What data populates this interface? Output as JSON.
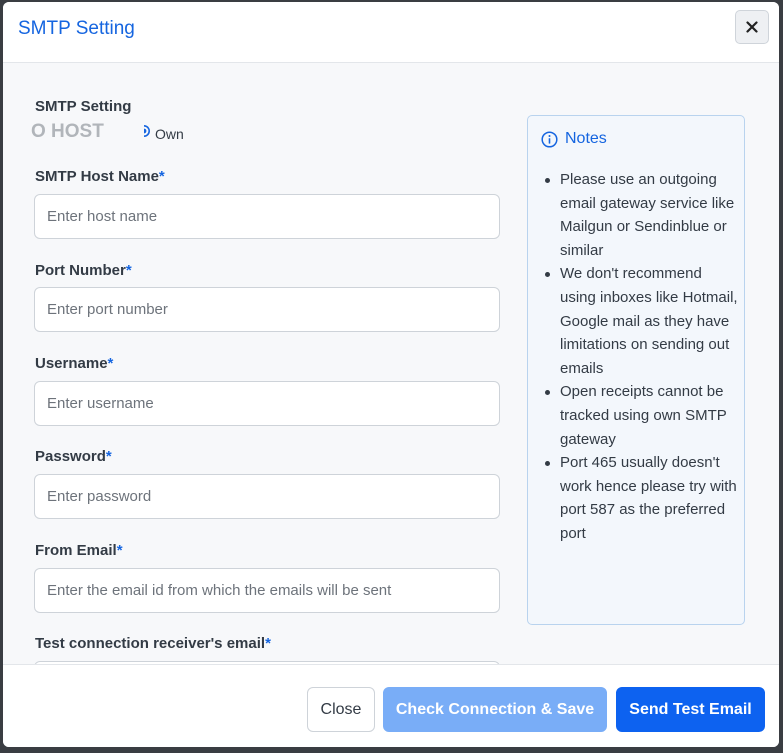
{
  "modal": {
    "title": "SMTP Setting",
    "close_icon": "close-icon"
  },
  "form": {
    "section_label": "SMTP Setting",
    "mode_options": [
      {
        "label": "O HOST",
        "selected": false
      },
      {
        "label": "Own",
        "selected": true
      }
    ],
    "required_marker": "*",
    "fields": [
      {
        "label": "SMTP Host Name",
        "placeholder": "Enter host name",
        "value": ""
      },
      {
        "label": "Port Number",
        "placeholder": "Enter port number",
        "value": ""
      },
      {
        "label": "Username",
        "placeholder": "Enter username",
        "value": ""
      },
      {
        "label": "Password",
        "placeholder": "Enter password",
        "value": ""
      },
      {
        "label": "From Email",
        "placeholder": "Enter the email id from which the emails will be sent",
        "value": ""
      },
      {
        "label": "Test connection receiver's email",
        "placeholder": "",
        "value": ""
      }
    ]
  },
  "notes": {
    "icon": "info-icon",
    "title": "Notes",
    "items": [
      "Please use an outgoing email gateway service like Mailgun or Sendinblue or similar",
      "We don't recommend using inboxes like Hotmail, Google mail as they have limitations on sending out emails",
      "Open receipts cannot be tracked using own SMTP gateway",
      "Port 465 usually doesn't work hence please try with port 587 as the preferred port"
    ]
  },
  "footer": {
    "close_label": "Close",
    "check_label": "Check Connection & Save",
    "send_label": "Send Test Email"
  },
  "colors": {
    "accent": "#1565e0",
    "primary_button": "#0d62f0",
    "disabled_button": "#79adf7",
    "notes_background": "#f3f7fc",
    "notes_border": "#b9d3ee"
  }
}
